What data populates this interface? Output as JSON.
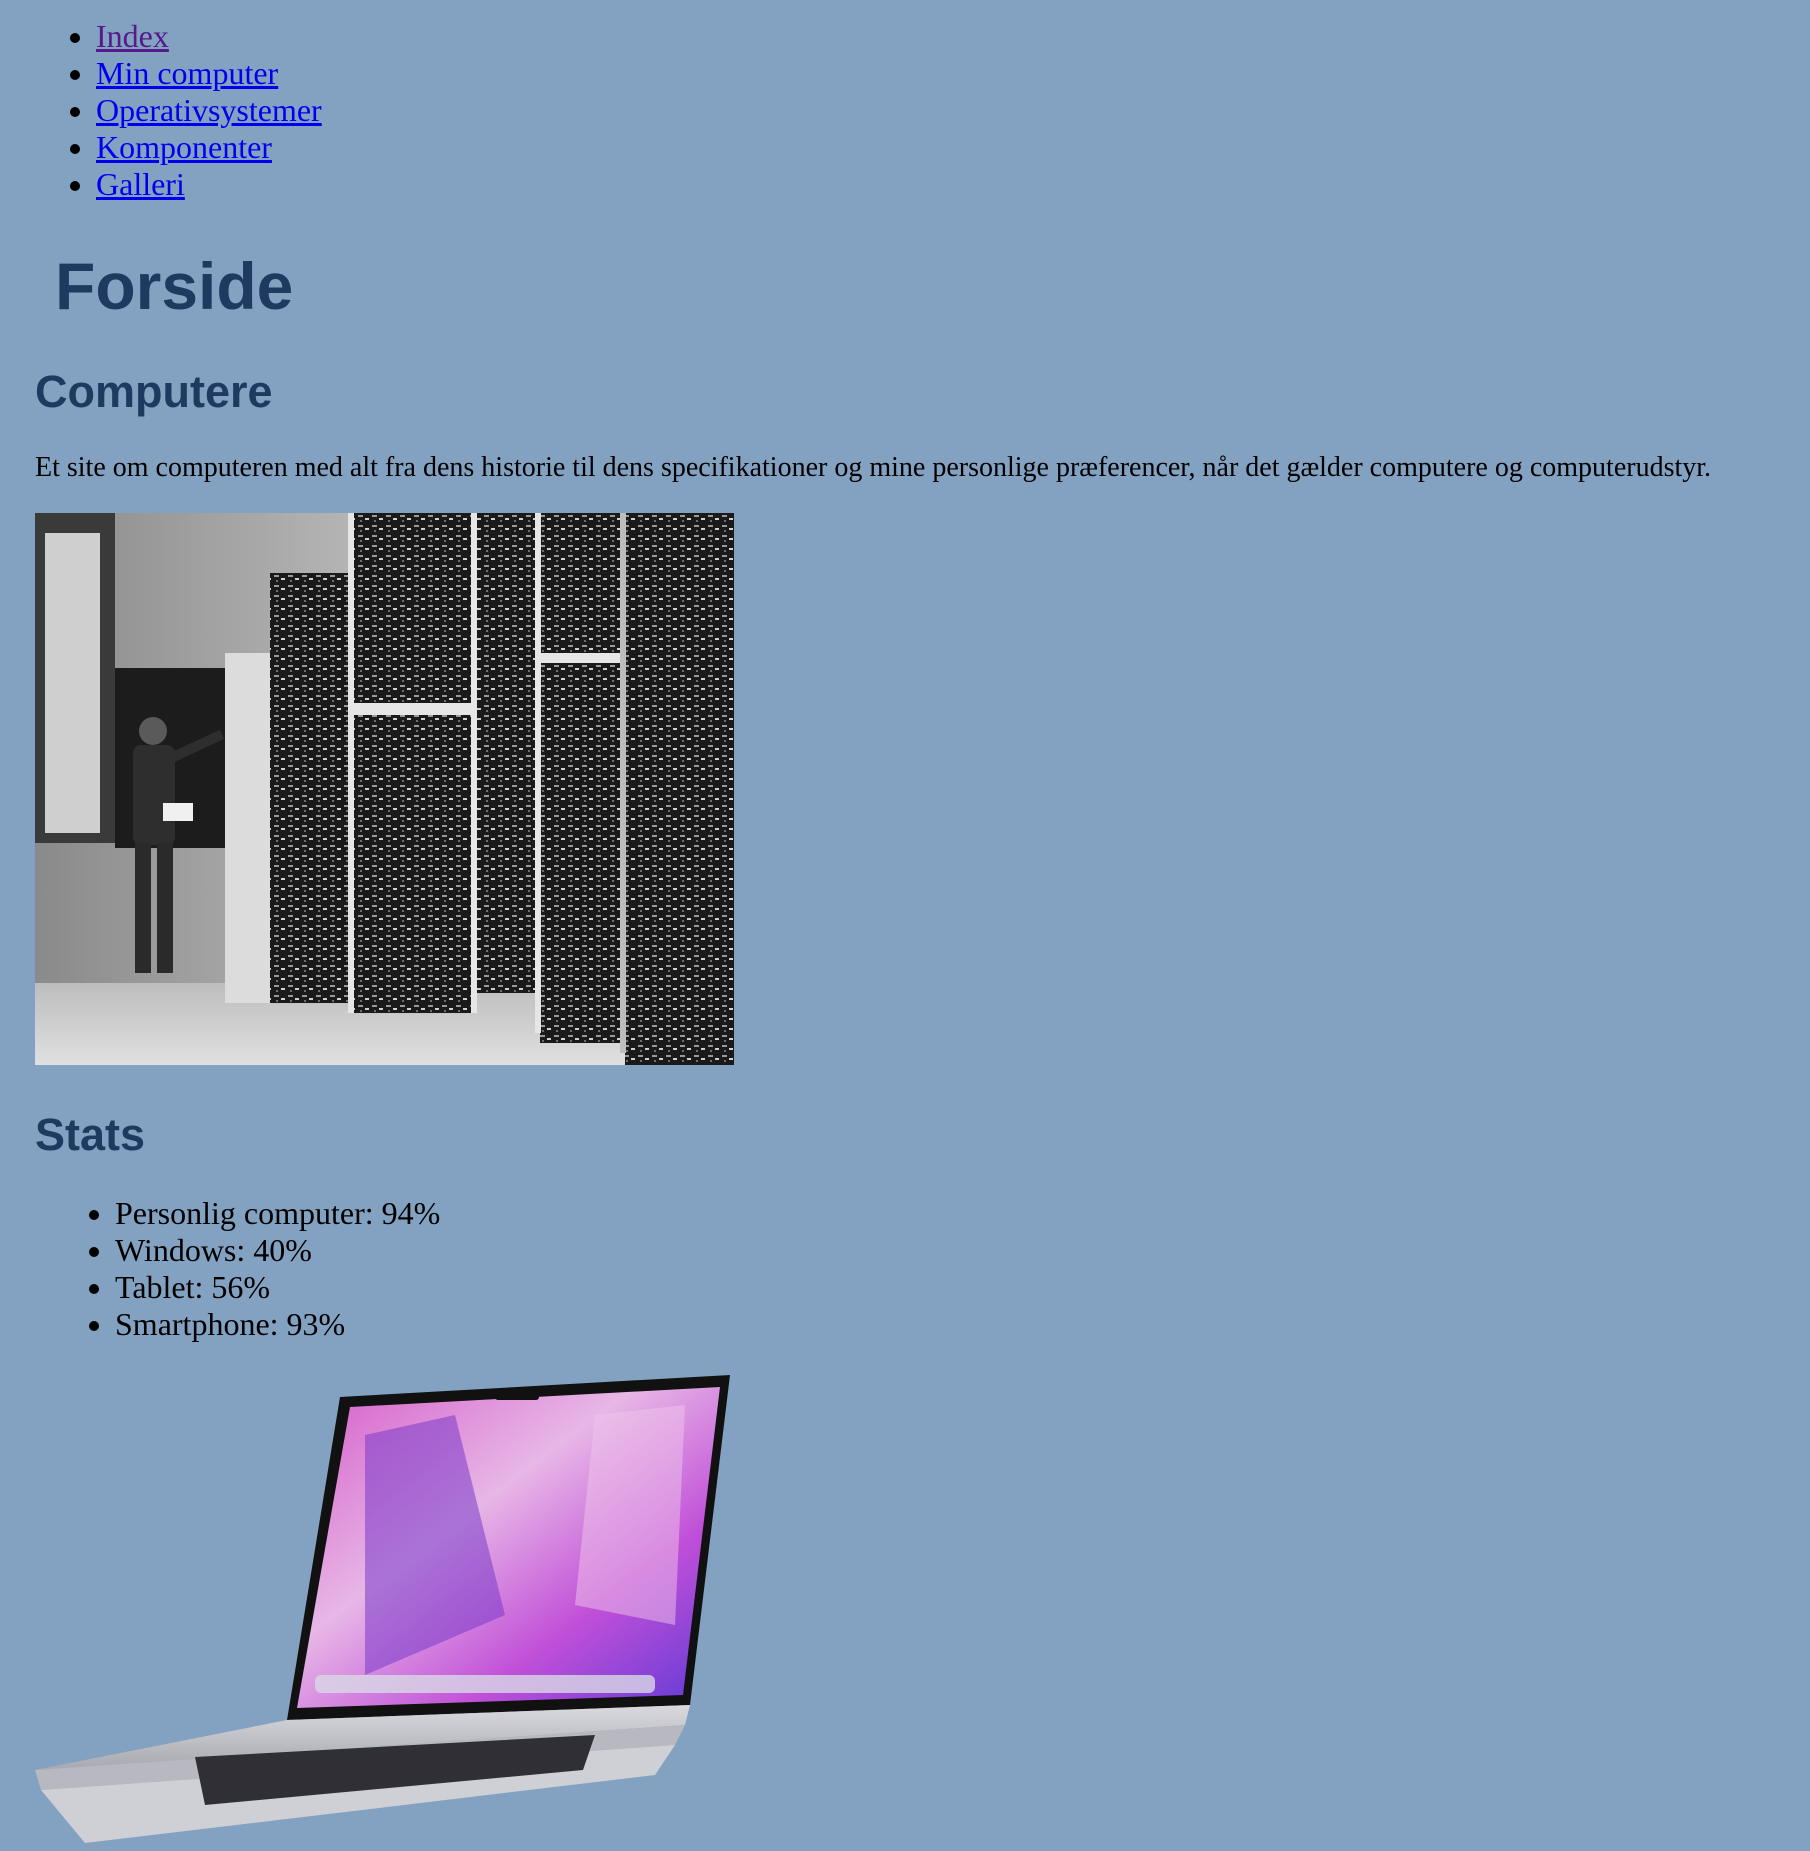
{
  "nav": {
    "items": [
      {
        "label": "Index",
        "visited": true
      },
      {
        "label": "Min computer"
      },
      {
        "label": "Operativsystemer"
      },
      {
        "label": "Komponenter"
      },
      {
        "label": "Galleri"
      }
    ]
  },
  "page": {
    "title": "Forside"
  },
  "sections": {
    "computere": {
      "heading": "Computere",
      "text": "Et site om computeren med alt fra dens historie til dens specifikationer og mine personlige præferencer, når det gælder computere og computerudstyr."
    },
    "stats": {
      "heading": "Stats",
      "items": [
        "Personlig computer: 94%",
        "Windows: 40%",
        "Tablet: 56%",
        "Smartphone: 93%"
      ]
    }
  },
  "colors": {
    "background": "#83a2c1",
    "heading": "#1f3a5f",
    "link": "#0000ee",
    "visited_link": "#551a8b"
  }
}
